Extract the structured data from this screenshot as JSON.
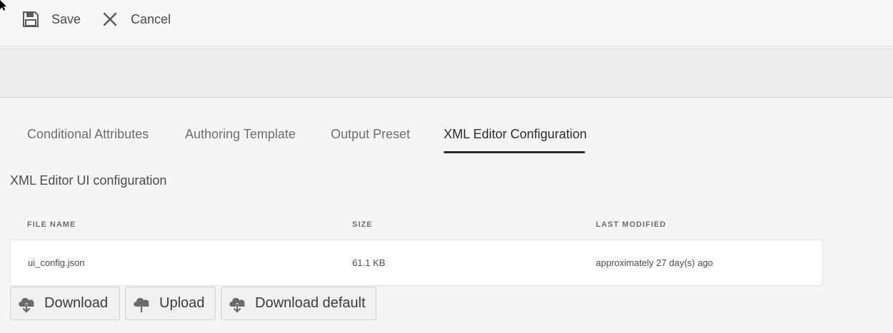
{
  "toolbar": {
    "save_label": "Save",
    "cancel_label": "Cancel"
  },
  "tabs": [
    {
      "label": "Conditional Attributes"
    },
    {
      "label": "Authoring Template"
    },
    {
      "label": "Output Preset"
    },
    {
      "label": "XML Editor Configuration",
      "active": true
    }
  ],
  "section": {
    "title": "XML Editor UI configuration"
  },
  "table": {
    "columns": [
      "FILE NAME",
      "SIZE",
      "LAST MODIFIED"
    ],
    "rows": [
      {
        "file_name": "ui_config.json",
        "size": "61.1 KB",
        "last_modified": "approximately 27 day(s) ago"
      }
    ]
  },
  "actions": {
    "download_label": "Download",
    "upload_label": "Upload",
    "download_default_label": "Download default"
  },
  "icons": {
    "save": "floppy-disk-icon",
    "cancel": "close-icon",
    "download": "cloud-download-icon",
    "upload": "cloud-upload-icon"
  }
}
